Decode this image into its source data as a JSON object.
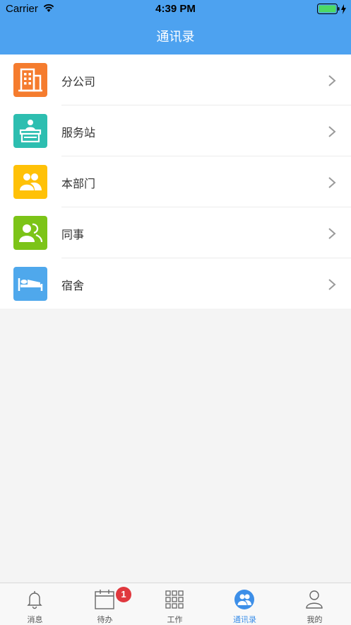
{
  "status_bar": {
    "carrier": "Carrier",
    "time": "4:39 PM"
  },
  "nav": {
    "title": "通讯录"
  },
  "list": {
    "items": [
      {
        "label": "分公司",
        "icon": "office-building-icon",
        "color": "#f57c2e"
      },
      {
        "label": "服务站",
        "icon": "service-desk-icon",
        "color": "#2dbeb0"
      },
      {
        "label": "本部门",
        "icon": "department-people-icon",
        "color": "#ffc107"
      },
      {
        "label": "同事",
        "icon": "colleague-icon",
        "color": "#7cc418"
      },
      {
        "label": "宿舍",
        "icon": "bed-icon",
        "color": "#4fa8ec"
      }
    ]
  },
  "tabbar": {
    "tabs": [
      {
        "label": "消息",
        "icon": "bell-icon"
      },
      {
        "label": "待办",
        "icon": "calendar-icon",
        "badge": "1"
      },
      {
        "label": "工作",
        "icon": "grid-icon"
      },
      {
        "label": "通讯录",
        "icon": "contacts-icon",
        "active": true
      },
      {
        "label": "我的",
        "icon": "person-icon"
      }
    ]
  },
  "colors": {
    "header": "#4da2f0",
    "active_tab": "#3d8fe8",
    "badge": "#e0383e"
  }
}
